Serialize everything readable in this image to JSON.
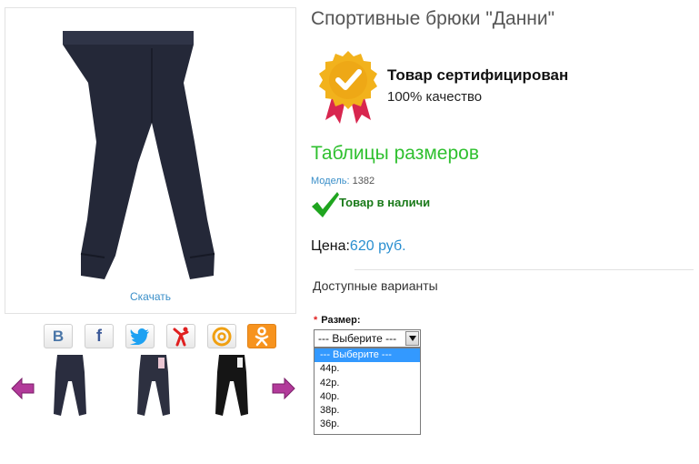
{
  "product": {
    "title": "Спортивные брюки \"Данни\"",
    "download_label": "Скачать"
  },
  "certificate": {
    "title": "Товар сертифицирован",
    "subtitle": "100% качество"
  },
  "size_tables_link": "Таблицы размеров",
  "model": {
    "label": "Модель:",
    "value": "1382"
  },
  "stock": {
    "label": "Товар в наличи",
    "icon": "checkmark-icon"
  },
  "price": {
    "label": "Цена:",
    "value": "620 руб."
  },
  "variants": {
    "heading": "Доступные варианты"
  },
  "size": {
    "required_mark": "*",
    "label": "Размер:",
    "selected": "--- Выберите ---",
    "options": [
      "--- Выберите ---",
      "44р.",
      "42р.",
      "40р.",
      "38р.",
      "36р."
    ]
  },
  "share_icons": [
    "vk-icon",
    "facebook-icon",
    "twitter-icon",
    "yandex-icon",
    "mail-icon",
    "odnoklassniki-icon"
  ],
  "thumbnails": [
    {
      "name": "thumbnail-navy-pants",
      "color": "#2a2d3f"
    },
    {
      "name": "thumbnail-navy-pants-tag",
      "color": "#2d3040"
    },
    {
      "name": "thumbnail-black-pants",
      "color": "#151515"
    }
  ],
  "colors": {
    "accent_green": "#2fc02f",
    "link_blue": "#3a8fc9",
    "price_blue": "#2a8fd0",
    "badge_gold": "#f2b21c",
    "ribbon_red": "#d8264f",
    "arrow_purple": "#b23a9a"
  }
}
